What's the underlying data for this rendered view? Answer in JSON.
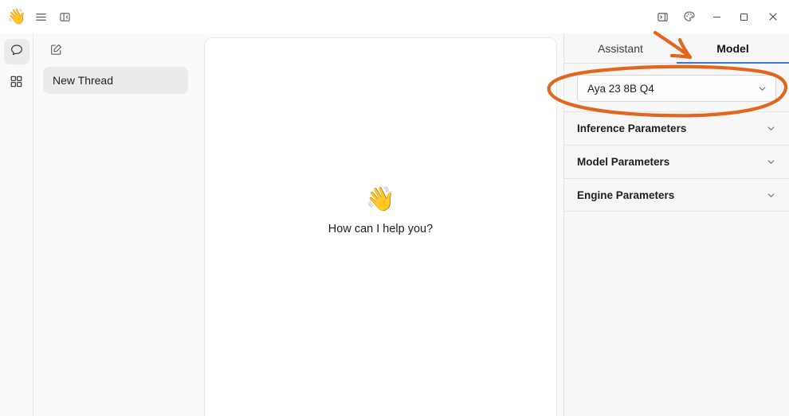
{
  "titlebar": {
    "logo_emoji": "👋",
    "menu_icon": "hamburger-menu-icon",
    "panel_toggle_icon": "panel-collapse-left-icon",
    "right_panel_toggle_icon": "panel-expand-right-icon",
    "theme_icon": "palette-icon",
    "minimize_label": "−",
    "maximize_label": "□",
    "close_label": "×"
  },
  "rail": {
    "items": [
      {
        "name": "chat",
        "icon": "chat-bubble-icon",
        "active": true
      },
      {
        "name": "apps",
        "icon": "grid-apps-icon",
        "active": false
      }
    ]
  },
  "sidebar": {
    "compose_icon": "compose-new-thread-icon",
    "threads": [
      {
        "label": "New Thread",
        "selected": true
      }
    ]
  },
  "main": {
    "empty_state": {
      "emoji": "👋",
      "text": "How can I help you?"
    }
  },
  "right_panel": {
    "tabs": [
      {
        "label": "Assistant",
        "active": false
      },
      {
        "label": "Model",
        "active": true
      }
    ],
    "model_select": {
      "value": "Aya 23 8B Q4",
      "chevron_icon": "chevron-down-icon"
    },
    "parameters": [
      {
        "label": "Inference Parameters",
        "chevron_icon": "chevron-down-icon"
      },
      {
        "label": "Model Parameters",
        "chevron_icon": "chevron-down-icon"
      },
      {
        "label": "Engine Parameters",
        "chevron_icon": "chevron-down-icon"
      }
    ]
  },
  "annotations": {
    "accent_color": "#E2661E",
    "arrow": "hand-drawn-arrow-pointing-to-model-tab",
    "ellipse": "hand-drawn-ellipse-around-model-select"
  },
  "colors": {
    "accent_blue": "#3A76D8",
    "annotation_orange": "#E2661E",
    "panel_bg": "#F7F7F7",
    "sidebar_bg": "#FAFAFA"
  }
}
